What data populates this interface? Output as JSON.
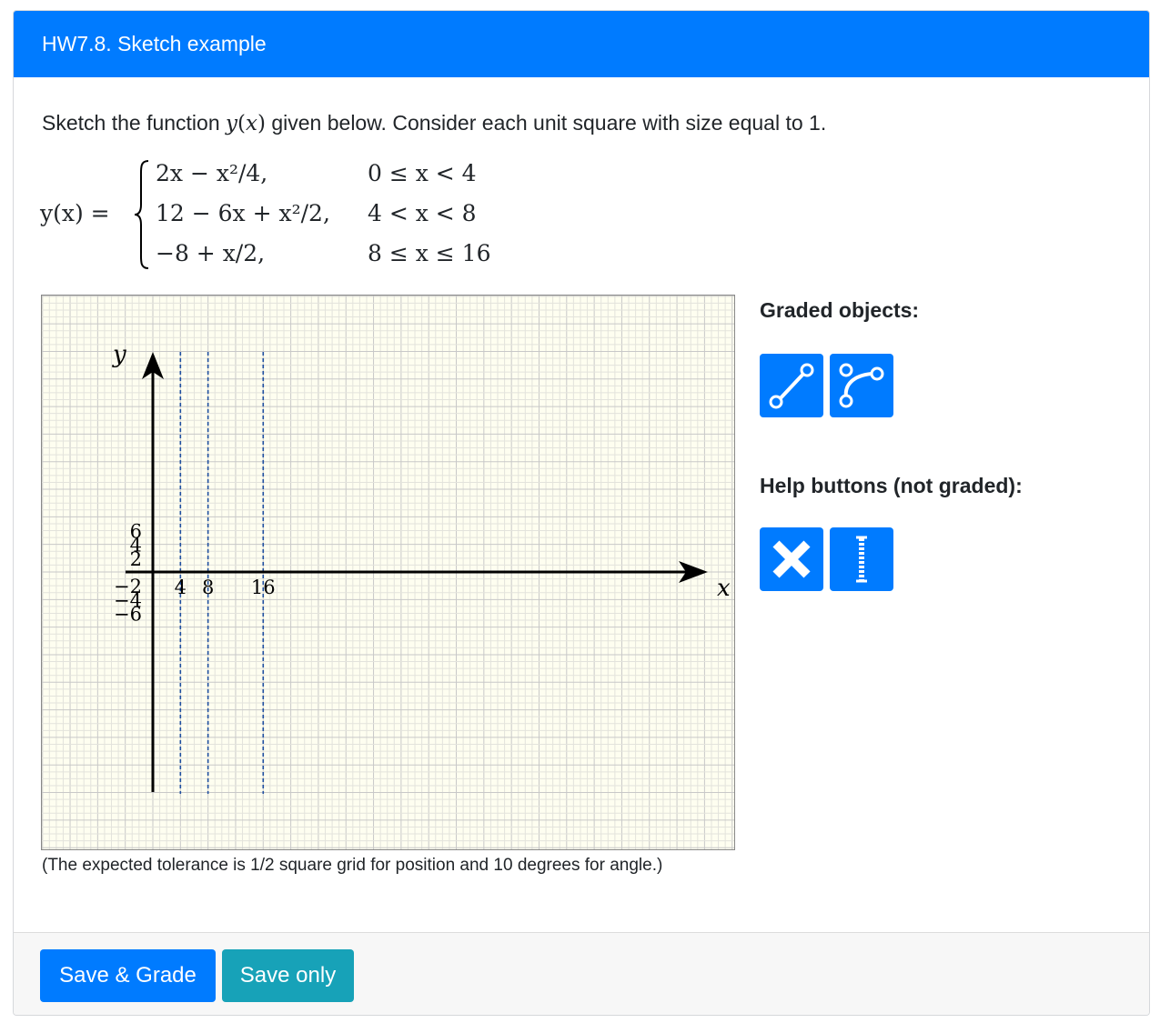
{
  "header": {
    "title": "HW7.8. Sketch example"
  },
  "question": {
    "text_before": "Sketch the function",
    "fn_var": "y",
    "fn_paren_open": "(",
    "fn_arg": "x",
    "fn_paren_close": ")",
    "text_after": "given below. Consider each unit square with size equal to 1.",
    "equation": {
      "lhs": "y(x) =",
      "pieces": [
        {
          "expr": "2x − x²/4,",
          "cond": "0 ≤ x < 4"
        },
        {
          "expr": "12 − 6x + x²/2,",
          "cond": "4 < x < 8"
        },
        {
          "expr": "−8 + x/2,",
          "cond": "8 ≤ x ≤ 16"
        }
      ]
    }
  },
  "plot": {
    "x_axis_label": "x",
    "y_axis_label": "y",
    "x_tick_labels": [
      "4",
      "8",
      "16"
    ],
    "y_tick_labels": [
      "6",
      "4",
      "2",
      "−2",
      "−4",
      "−6"
    ],
    "vertical_guides_x": [
      4,
      8,
      16
    ],
    "x_range": [
      -4,
      21
    ],
    "y_range": [
      -9,
      11
    ],
    "grid": "unit squares",
    "background_color": "#fefef0",
    "guide_color": "#1f4fa0"
  },
  "tolerance_note": "(The expected tolerance is 1/2 square grid for position and 10 degrees for angle.)",
  "graded_objects": {
    "heading": "Graded objects:",
    "tools": [
      {
        "icon": "line-segment-icon"
      },
      {
        "icon": "spline-curve-icon"
      }
    ]
  },
  "help_buttons": {
    "heading": "Help buttons (not graded):",
    "tools": [
      {
        "icon": "delete-x-icon"
      },
      {
        "icon": "vertical-guide-icon"
      }
    ]
  },
  "footer": {
    "save_grade_label": "Save & Grade",
    "save_only_label": "Save only",
    "save_grade_color": "#007bff",
    "save_only_color": "#17a2b8"
  }
}
